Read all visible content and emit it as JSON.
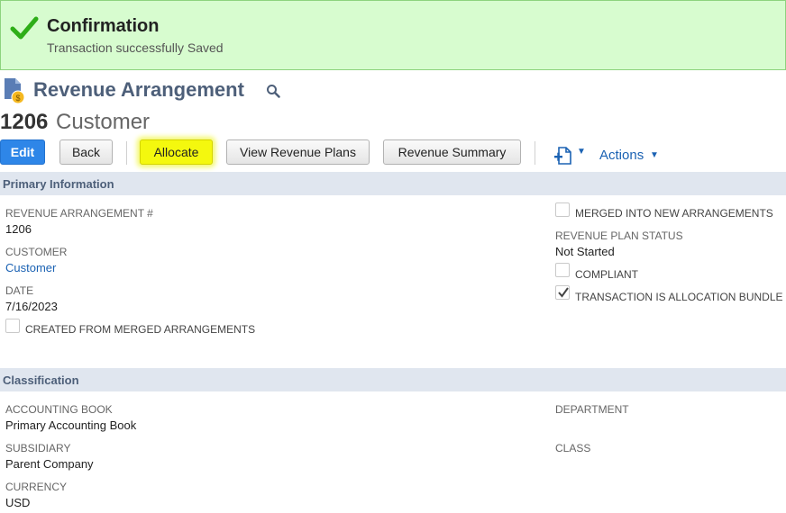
{
  "confirmation": {
    "title": "Confirmation",
    "message": "Transaction successfully Saved",
    "icon": "checkmark-icon",
    "color": "#2eae18"
  },
  "header": {
    "page_title": "Revenue Arrangement",
    "record_id": "1206",
    "record_name": "Customer"
  },
  "toolbar": {
    "edit_label": "Edit",
    "back_label": "Back",
    "allocate_label": "Allocate",
    "view_plans_label": "View Revenue Plans",
    "summary_label": "Revenue Summary",
    "actions_label": "Actions",
    "accent": "#2e86e8",
    "highlight": "#f4f80e"
  },
  "primary": {
    "section_title": "Primary Information",
    "fields": [
      {
        "label": "REVENUE ARRANGEMENT #",
        "value": "1206"
      },
      {
        "label": "CUSTOMER",
        "value": "Customer"
      },
      {
        "label": "DATE",
        "value": "7/16/2023"
      }
    ],
    "created_from_merged": {
      "label": "CREATED FROM MERGED ARRANGEMENTS",
      "checked": false
    },
    "merged_into_new": {
      "label": "MERGED INTO NEW ARRANGEMENTS",
      "checked": false
    },
    "plan_status": {
      "label": "REVENUE PLAN STATUS",
      "value": "Not Started"
    },
    "compliant": {
      "label": "COMPLIANT",
      "checked": false
    },
    "allocation_bundle": {
      "label": "TRANSACTION IS ALLOCATION BUNDLE",
      "checked": true
    }
  },
  "classification": {
    "section_title": "Classification",
    "fields": [
      {
        "label": "ACCOUNTING BOOK",
        "value": "Primary Accounting Book"
      },
      {
        "label": "SUBSIDIARY",
        "value": "Parent Company"
      },
      {
        "label": "CURRENCY",
        "value": "USD"
      }
    ],
    "department": {
      "label": "DEPARTMENT",
      "value": ""
    },
    "class": {
      "label": "CLASS",
      "value": ""
    }
  }
}
